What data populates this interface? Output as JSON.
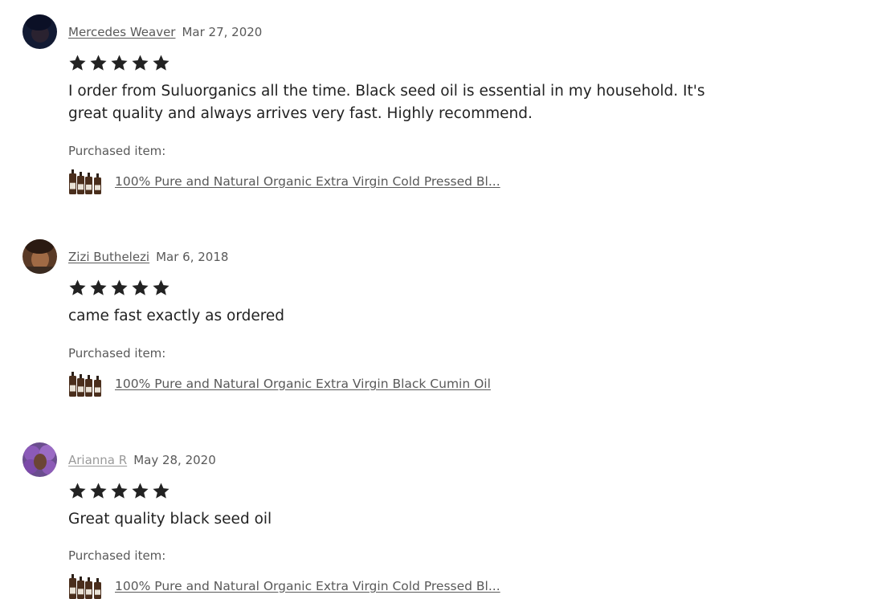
{
  "reviews": [
    {
      "name": "Mercedes Weaver",
      "date": "Mar 27, 2020",
      "rating": 5,
      "text": "I order from Suluorganics all the time. Black seed oil is essential in my household. It's great quality and always arrives very fast. Highly recommend.",
      "purchased_label": "Purchased item:",
      "item": "100% Pure and Natural Organic Extra Virgin Cold Pressed Bl..."
    },
    {
      "name": "Zizi Buthelezi",
      "date": "Mar 6, 2018",
      "rating": 5,
      "text": "came fast exactly as ordered",
      "purchased_label": "Purchased item:",
      "item": "100% Pure and Natural Organic Extra Virgin Black Cumin Oil"
    },
    {
      "name": "Arianna R",
      "date": "May 28, 2020",
      "rating": 5,
      "text": "Great quality black seed oil",
      "purchased_label": "Purchased item:",
      "item": "100% Pure and Natural Organic Extra Virgin Cold Pressed Bl..."
    }
  ],
  "colors": {
    "star": "#222222",
    "link": "#595959",
    "muted_name": "#9a9a9a"
  }
}
